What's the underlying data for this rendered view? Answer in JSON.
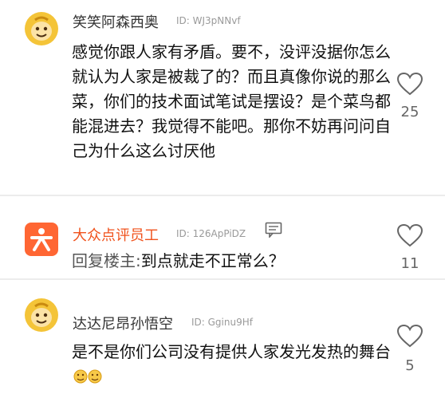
{
  "comments": [
    {
      "username": "笑笑阿森西奥",
      "uid": "ID: WJ3pNNvf",
      "text": "感觉你跟人家有矛盾。要不，没评没据你怎么就认为人家是被裁了的？而且真像你说的那么菜，你们的技术面试笔试是摆设？是个菜鸟都能混进去？我觉得不能吧。那你不妨再问问自己为什么这么讨厌他",
      "likes": "25"
    },
    {
      "username": "大众点评员工",
      "uid": "ID: 126ApPiDZ",
      "reply_prefix": "回复楼主:",
      "text": "到点就走不正常么？",
      "likes": "11"
    },
    {
      "username": "达达尼昂孙悟空",
      "uid": "ID: Gginu9Hf",
      "text": "是不是你们公司没有提供人家发光发热的舞台",
      "likes": "5"
    }
  ],
  "colors": {
    "staff_name": "#f0521c",
    "monkey_avatar": "#f4c438",
    "dianping_logo": "#ff6633"
  },
  "icons": [
    "monkey-avatar-icon",
    "dianping-logo-icon",
    "message-icon",
    "heart-icon",
    "emoji-icon"
  ]
}
